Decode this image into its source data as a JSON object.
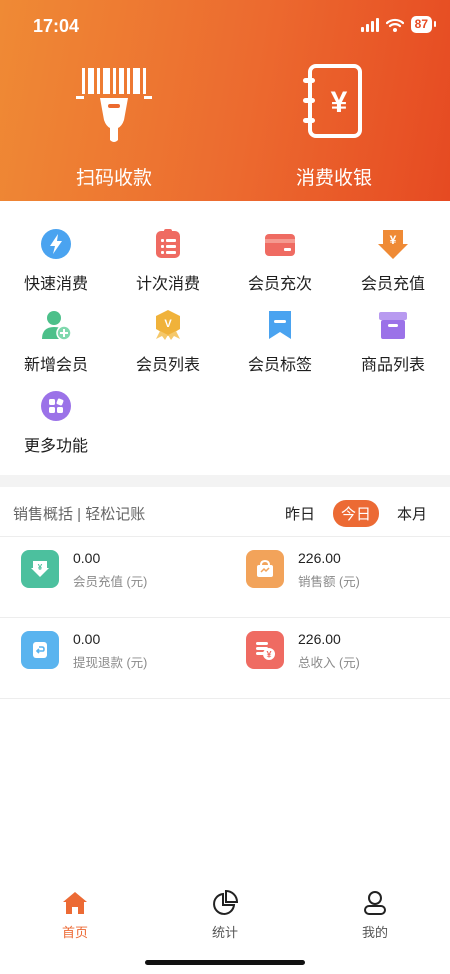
{
  "status_bar": {
    "time": "17:04",
    "battery": "87"
  },
  "hero": {
    "scan_label": "扫码收款",
    "cashier_label": "消费收银"
  },
  "menu": [
    {
      "label": "快速消费",
      "icon": "lightning-icon",
      "color": "#4aa3f0"
    },
    {
      "label": "计次消费",
      "icon": "clipboard-list-icon",
      "color": "#ef6b62"
    },
    {
      "label": "会员充次",
      "icon": "card-icon",
      "color": "#ef6b62"
    },
    {
      "label": "会员充值",
      "icon": "yen-down-arrow-icon",
      "color": "#ef8a35"
    },
    {
      "label": "新增会员",
      "icon": "add-user-icon",
      "color": "#4cc08a"
    },
    {
      "label": "会员列表",
      "icon": "vip-badge-icon",
      "color": "#f0b23a"
    },
    {
      "label": "会员标签",
      "icon": "bookmark-icon",
      "color": "#4aa3f0"
    },
    {
      "label": "商品列表",
      "icon": "archive-box-icon",
      "color": "#9b72e8"
    },
    {
      "label": "更多功能",
      "icon": "apps-grid-icon",
      "color": "#9b72e8"
    }
  ],
  "sales": {
    "title": "销售概括 | 轻松记账",
    "ranges": [
      "昨日",
      "今日",
      "本月"
    ],
    "active_range": "今日",
    "stats": [
      {
        "value": "0.00",
        "label": "会员充值 (元)",
        "icon": "download-arrow-icon",
        "color": "#4cc09e"
      },
      {
        "value": "226.00",
        "label": "销售额 (元)",
        "icon": "shopping-bag-icon",
        "color": "#f2a35a"
      },
      {
        "value": "0.00",
        "label": "提现退款 (元)",
        "icon": "refund-icon",
        "color": "#5ab4ef"
      },
      {
        "value": "226.00",
        "label": "总收入 (元)",
        "icon": "coins-yen-icon",
        "color": "#ef6b62"
      }
    ]
  },
  "tabbar": [
    {
      "label": "首页",
      "icon": "home-icon",
      "active": true
    },
    {
      "label": "统计",
      "icon": "pie-chart-icon",
      "active": false
    },
    {
      "label": "我的",
      "icon": "user-icon",
      "active": false
    }
  ]
}
